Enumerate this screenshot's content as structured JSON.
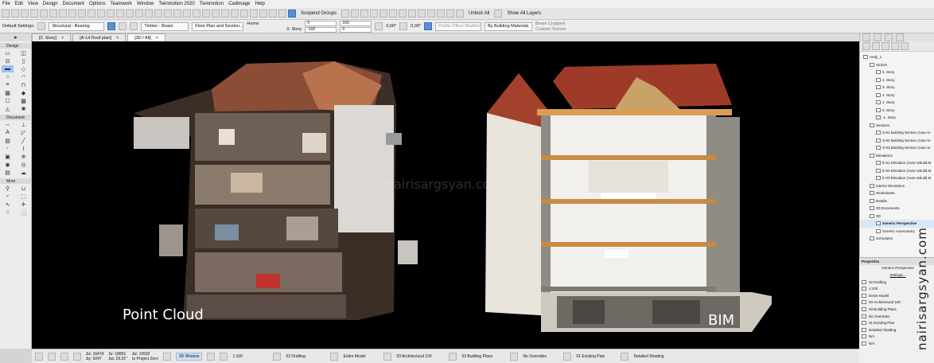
{
  "menu": [
    "File",
    "Edit",
    "View",
    "Design",
    "Document",
    "Options",
    "Teamwork",
    "Window",
    "Twinmotion 2020",
    "Twinmotion",
    "Cadimage",
    "Help"
  ],
  "toolbar": {
    "suspend_groups": "Suspend Groups",
    "unlock_all": "Unlock All",
    "show_all_layers": "Show All Layers"
  },
  "infobox": {
    "default_settings": "Default Settings:",
    "structural": "Structural - Bearing",
    "timber": "Timber - Beam",
    "floorplan": "Floor Plan and Section...",
    "home": "Home:",
    "story": "0. Story",
    "v1": "0",
    "v2": "-100",
    "v3": "160",
    "v4": "0",
    "angle1": "0,00°",
    "angle2": "0,00°",
    "profile": "Profile Offset Modifiers...",
    "material": "By Building Materials",
    "beam_cropped": "Beam Cropped",
    "custom_texture": "Custom Texture"
  },
  "toolbox": {
    "design": "Design",
    "document": "Document",
    "more": "More"
  },
  "tabs": [
    "[0. Story]",
    "[A-14 Roof plan]",
    "[3D / All]"
  ],
  "viewport": {
    "left_label": "Point Cloud",
    "right_label": "BIM",
    "watermark_center": "nairisargsyan.com"
  },
  "statusbar": {
    "n1": "N/A",
    "n2": "N/A",
    "dx": "Δx: 16474",
    "dy": "Δy: 9247",
    "dr": "Δr: 18891",
    "da": "Δα: 29,31°",
    "dz": "Δz: 10592",
    "to_project_zero": "to Project Zero",
    "window_3d": "3D Window",
    "scale": "1:100",
    "drafting": "02 Drafting",
    "model": "Entire Model",
    "arch": "03 Architectural 100",
    "plans": "03 Building Plans",
    "overrides": "No Overrides",
    "existing": "01 Existing Plan",
    "shading": "Detailed Shading"
  },
  "navigator": {
    "tree": [
      {
        "label": "Andy_1",
        "depth": 0
      },
      {
        "label": "Stories",
        "depth": 1
      },
      {
        "label": "5. Story",
        "depth": 2
      },
      {
        "label": "4. Story",
        "depth": 2
      },
      {
        "label": "3. Story",
        "depth": 2
      },
      {
        "label": "2. Story",
        "depth": 2
      },
      {
        "label": "1. Story",
        "depth": 2
      },
      {
        "label": "0. Story",
        "depth": 2
      },
      {
        "label": "-1. Story",
        "depth": 2
      },
      {
        "label": "Sections",
        "depth": 1
      },
      {
        "label": "S-01 Building Section (Auto-re",
        "depth": 2
      },
      {
        "label": "S-02 Building Section (Auto-re",
        "depth": 2
      },
      {
        "label": "S-03 Building Section (Auto-re",
        "depth": 2
      },
      {
        "label": "Elevations",
        "depth": 1
      },
      {
        "label": "E-01 Elevation (Auto-rebuild M",
        "depth": 2
      },
      {
        "label": "E-02 Elevation (Auto-rebuild M",
        "depth": 2
      },
      {
        "label": "E-03 Elevation (Auto-rebuild M",
        "depth": 2
      },
      {
        "label": "Interior Elevations",
        "depth": 1
      },
      {
        "label": "Worksheets",
        "depth": 1
      },
      {
        "label": "Details",
        "depth": 1
      },
      {
        "label": "3D Documents",
        "depth": 1
      },
      {
        "label": "3D",
        "depth": 1
      },
      {
        "label": "Generic Perspective",
        "depth": 2
      },
      {
        "label": "Generic Axonometry",
        "depth": 2
      },
      {
        "label": "Schedules",
        "depth": 1
      }
    ]
  },
  "properties": {
    "title": "Properties",
    "view": "Generic Perspective",
    "settings": "Settings...",
    "rows": [
      "02 Drafting",
      "1:100",
      "Entire Model",
      "03 Architectural 100",
      "03 Building Plans",
      "No Overrides",
      "01 Existing Plan",
      "Detailed Shading",
      "N/A",
      "N/A"
    ]
  },
  "watermark": "nairisargsyan.com"
}
